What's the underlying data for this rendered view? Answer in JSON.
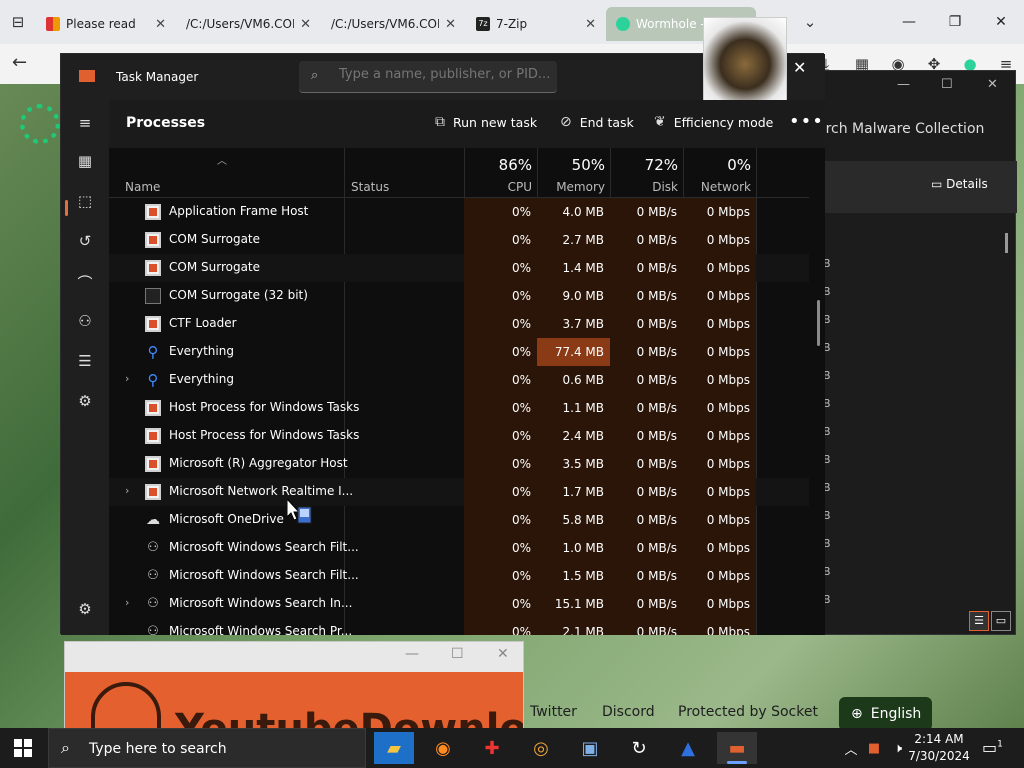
{
  "browser": {
    "tabs": [
      {
        "label": "Please read",
        "icon": "arrows-updown-icon"
      },
      {
        "label": "/C:/Users/VM6.COLL",
        "icon": ""
      },
      {
        "label": "/C:/Users/VM6.COLL",
        "icon": ""
      },
      {
        "label": "7-Zip",
        "icon": "7zip-icon"
      },
      {
        "label": "Wormhole - Sim",
        "icon": "wormhole-icon"
      }
    ],
    "add_tab": "+",
    "tab_list": "⌄"
  },
  "bg_window": {
    "search_placeholder": "arch Malware Collection",
    "details_label": "Details",
    "row_marks": [
      "B",
      "B",
      "B",
      "B",
      "B",
      "B",
      "B",
      "B",
      "B",
      "B",
      "B",
      "B",
      "B",
      "B"
    ]
  },
  "taskmanager": {
    "title": "Task Manager",
    "search_placeholder": "Type a name, publisher, or PID...",
    "page_title": "Processes",
    "toolbar": {
      "run_new_task": "Run new task",
      "end_task": "End task",
      "efficiency_mode": "Efficiency mode",
      "more": "•••"
    },
    "columns": {
      "name": "Name",
      "status": "Status",
      "cpu_pct": "86%",
      "cpu": "CPU",
      "memory_pct": "50%",
      "memory": "Memory",
      "disk_pct": "72%",
      "disk": "Disk",
      "network_pct": "0%",
      "network": "Network"
    },
    "processes": [
      {
        "name": "Application Frame Host",
        "icon": "box",
        "expand": "",
        "cpu": "0%",
        "memory": "4.0 MB",
        "disk": "0 MB/s",
        "network": "0 Mbps"
      },
      {
        "name": "COM Surrogate",
        "icon": "box",
        "expand": "",
        "cpu": "0%",
        "memory": "2.7 MB",
        "disk": "0 MB/s",
        "network": "0 Mbps"
      },
      {
        "name": "COM Surrogate",
        "icon": "box",
        "expand": "",
        "cpu": "0%",
        "memory": "1.4 MB",
        "disk": "0 MB/s",
        "network": "0 Mbps"
      },
      {
        "name": "COM Surrogate (32 bit)",
        "icon": "grey",
        "expand": "",
        "cpu": "0%",
        "memory": "9.0 MB",
        "disk": "0 MB/s",
        "network": "0 Mbps"
      },
      {
        "name": "CTF Loader",
        "icon": "box",
        "expand": "",
        "cpu": "0%",
        "memory": "3.7 MB",
        "disk": "0 MB/s",
        "network": "0 Mbps"
      },
      {
        "name": "Everything",
        "icon": "lens",
        "expand": "",
        "cpu": "0%",
        "memory": "77.4 MB",
        "disk": "0 MB/s",
        "network": "0 Mbps",
        "hot": true
      },
      {
        "name": "Everything",
        "icon": "lens",
        "expand": "›",
        "cpu": "0%",
        "memory": "0.6 MB",
        "disk": "0 MB/s",
        "network": "0 Mbps"
      },
      {
        "name": "Host Process for Windows Tasks",
        "icon": "box",
        "expand": "",
        "cpu": "0%",
        "memory": "1.1 MB",
        "disk": "0 MB/s",
        "network": "0 Mbps"
      },
      {
        "name": "Host Process for Windows Tasks",
        "icon": "box",
        "expand": "",
        "cpu": "0%",
        "memory": "2.4 MB",
        "disk": "0 MB/s",
        "network": "0 Mbps"
      },
      {
        "name": "Microsoft (R) Aggregator Host",
        "icon": "box",
        "expand": "",
        "cpu": "0%",
        "memory": "3.5 MB",
        "disk": "0 MB/s",
        "network": "0 Mbps"
      },
      {
        "name": "Microsoft Network Realtime I...",
        "icon": "box",
        "expand": "›",
        "cpu": "0%",
        "memory": "1.7 MB",
        "disk": "0 MB/s",
        "network": "0 Mbps"
      },
      {
        "name": "Microsoft OneDrive",
        "icon": "cloud",
        "expand": "",
        "cpu": "0%",
        "memory": "5.8 MB",
        "disk": "0 MB/s",
        "network": "0 Mbps"
      },
      {
        "name": "Microsoft Windows Search Filt...",
        "icon": "user",
        "expand": "",
        "cpu": "0%",
        "memory": "1.0 MB",
        "disk": "0 MB/s",
        "network": "0 Mbps"
      },
      {
        "name": "Microsoft Windows Search Filt...",
        "icon": "user",
        "expand": "",
        "cpu": "0%",
        "memory": "1.5 MB",
        "disk": "0 MB/s",
        "network": "0 Mbps"
      },
      {
        "name": "Microsoft Windows Search In...",
        "icon": "user",
        "expand": "›",
        "cpu": "0%",
        "memory": "15.1 MB",
        "disk": "0 MB/s",
        "network": "0 Mbps"
      },
      {
        "name": "Microsoft Windows Search Pr...",
        "icon": "user",
        "expand": "",
        "cpu": "0%",
        "memory": "2.1 MB",
        "disk": "0 MB/s",
        "network": "0 Mbps"
      }
    ]
  },
  "page": {
    "links": [
      "Twitter",
      "Discord",
      "Protected by Socket"
    ],
    "language": "English",
    "popup_heading": "YoutubeDownloa"
  },
  "taskbar": {
    "search_placeholder": "Type here to search",
    "time": "2:14 AM",
    "date": "7/30/2024",
    "notification_count": "1"
  },
  "colors": {
    "accent_orange": "#e06030",
    "memory_hot": "#8a3a14",
    "cell_bg": "#2b1408",
    "popup_orange": "#e4612f"
  }
}
